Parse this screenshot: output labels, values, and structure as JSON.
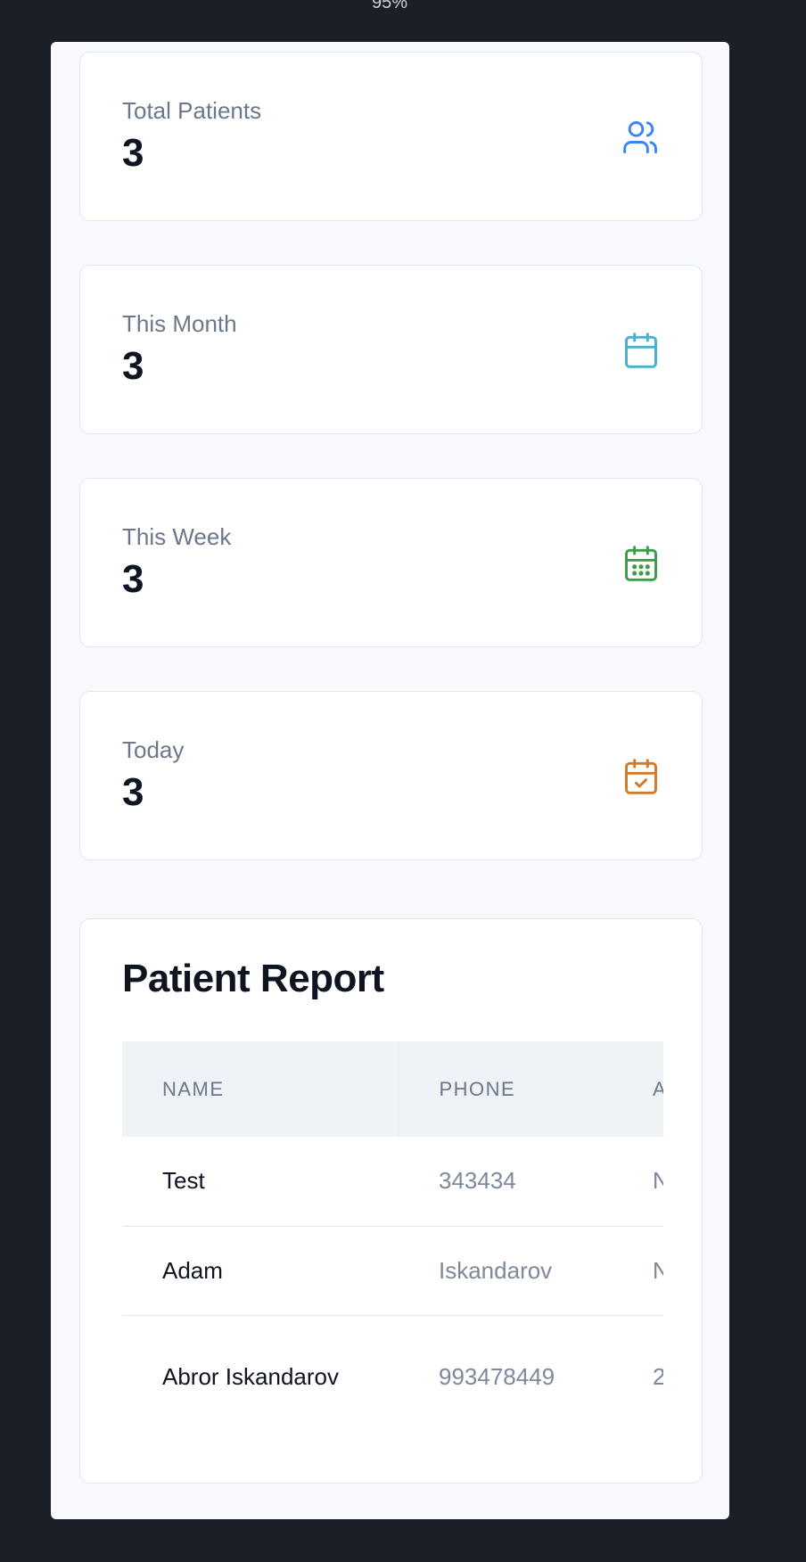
{
  "zoom": "95%",
  "stats": [
    {
      "label": "Total Patients",
      "value": "3",
      "icon": "users-icon",
      "color": "#3b82f6"
    },
    {
      "label": "This Month",
      "value": "3",
      "icon": "calendar-icon",
      "color": "#4bb0d0"
    },
    {
      "label": "This Week",
      "value": "3",
      "icon": "calendar-grid-icon",
      "color": "#3a9d4a"
    },
    {
      "label": "Today",
      "value": "3",
      "icon": "calendar-check-icon",
      "color": "#d17a2a"
    }
  ],
  "report": {
    "title": "Patient Report",
    "columns": [
      "NAME",
      "PHONE",
      "A"
    ],
    "rows": [
      {
        "name": "Test",
        "phone": "343434",
        "extra": "N"
      },
      {
        "name": "Adam",
        "phone": "Iskandarov",
        "extra": "N"
      },
      {
        "name": "Abror Iskandarov",
        "phone": "993478449",
        "extra": "2"
      }
    ]
  }
}
